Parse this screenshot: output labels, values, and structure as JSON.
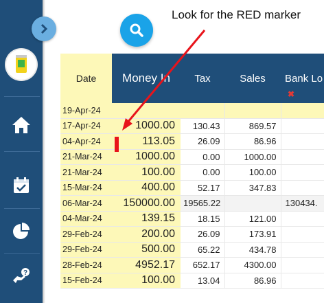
{
  "annotation": {
    "text": "Look for the RED marker",
    "color": "#e8141b"
  },
  "sidebar": {
    "background": "#1f4e79",
    "items": [
      {
        "name": "home",
        "icon": "home-icon"
      },
      {
        "name": "calendar",
        "icon": "calendar-check-icon"
      },
      {
        "name": "reports",
        "icon": "pie-chart-icon"
      },
      {
        "name": "help",
        "icon": "hand-question-icon"
      }
    ]
  },
  "toolbar": {
    "search_icon": "search-icon",
    "collapse_icon": "chevron-right-icon"
  },
  "table": {
    "columns": [
      "Date",
      "Money In",
      "Tax",
      "Sales",
      "Bank Lo"
    ],
    "delete_mark": "✖",
    "rows": [
      [
        "19-Apr-24",
        "",
        "",
        "",
        ""
      ],
      [
        "17-Apr-24",
        "1000.00",
        "130.43",
        "869.57",
        ""
      ],
      [
        "04-Apr-24",
        "113.05",
        "26.09",
        "86.96",
        ""
      ],
      [
        "21-Mar-24",
        "1000.00",
        "0.00",
        "1000.00",
        ""
      ],
      [
        "21-Mar-24",
        "100.00",
        "0.00",
        "100.00",
        ""
      ],
      [
        "15-Mar-24",
        "400.00",
        "52.17",
        "347.83",
        ""
      ],
      [
        "06-Mar-24",
        "150000.00",
        "19565.22",
        "",
        "130434."
      ],
      [
        "04-Mar-24",
        "139.15",
        "18.15",
        "121.00",
        ""
      ],
      [
        "29-Feb-24",
        "200.00",
        "26.09",
        "173.91",
        ""
      ],
      [
        "29-Feb-24",
        "500.00",
        "65.22",
        "434.78",
        ""
      ],
      [
        "28-Feb-24",
        "4952.17",
        "652.17",
        "4300.00",
        ""
      ],
      [
        "15-Feb-24",
        "100.00",
        "13.04",
        "86.96",
        ""
      ]
    ]
  }
}
